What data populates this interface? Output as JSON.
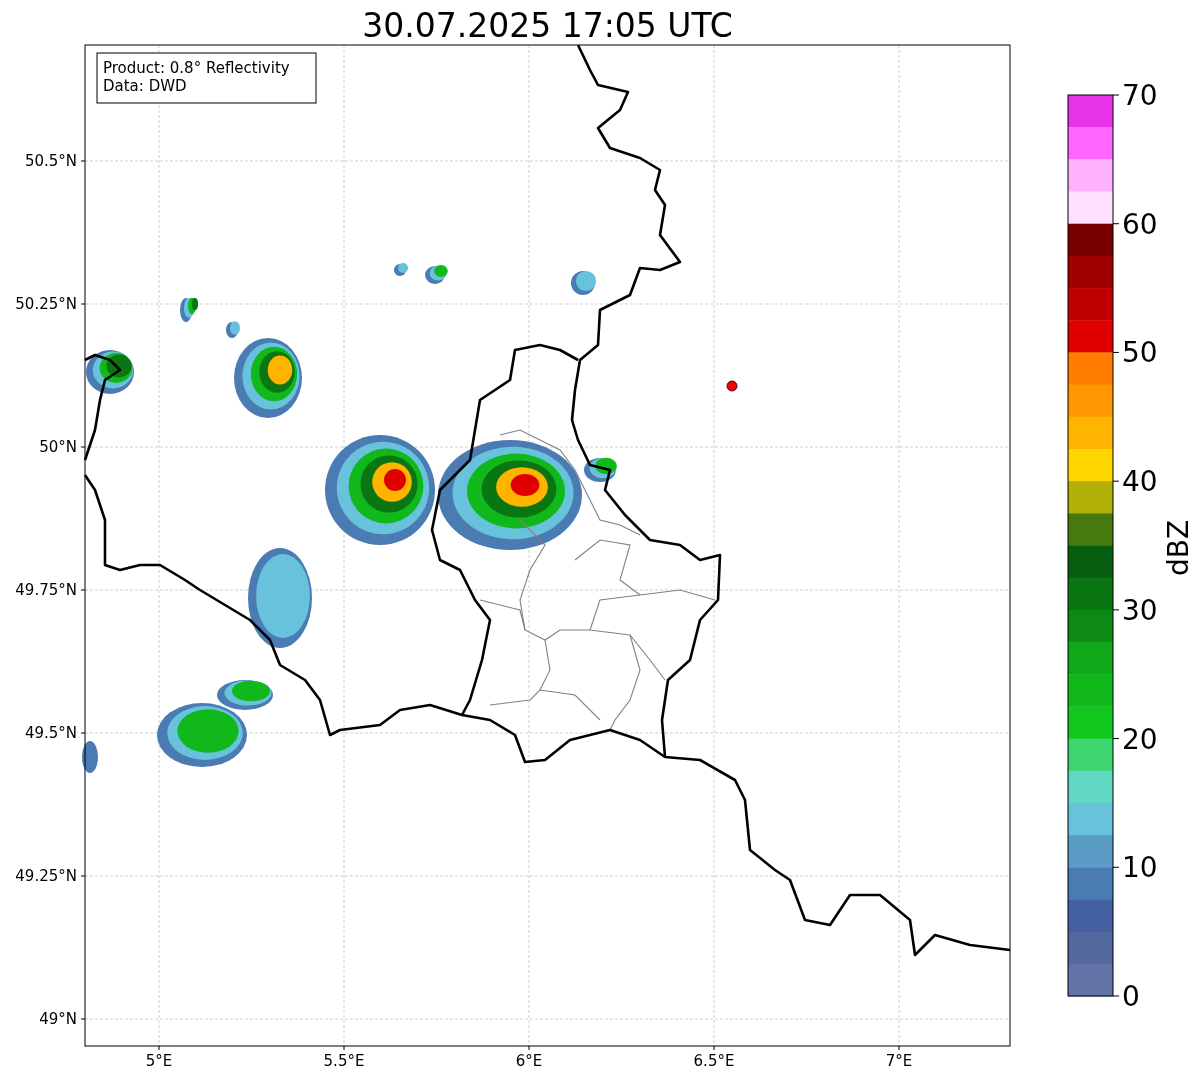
{
  "title": "30.07.2025 17:05 UTC",
  "legend": [
    "Product: 0.8° Reflectivity",
    "Data: DWD"
  ],
  "map": {
    "x_ticks": [
      "5°E",
      "5.5°E",
      "6°E",
      "6.5°E",
      "7°E"
    ],
    "y_ticks": [
      "50.5°N",
      "50.25°N",
      "50°N",
      "49.75°N",
      "49.5°N",
      "49.25°N",
      "49°N"
    ]
  },
  "colorbar": {
    "label": "dBZ",
    "ticks": [
      "70",
      "60",
      "50",
      "40",
      "30",
      "20",
      "10",
      "0"
    ],
    "bands": [
      {
        "color": "#e833e8"
      },
      {
        "color": "#ff66ff"
      },
      {
        "color": "#ffb0ff"
      },
      {
        "color": "#ffdfff"
      },
      {
        "color": "#7a0000"
      },
      {
        "color": "#a00000"
      },
      {
        "color": "#c00000"
      },
      {
        "color": "#e00000"
      },
      {
        "color": "#ff7c00"
      },
      {
        "color": "#ff9800"
      },
      {
        "color": "#ffb400"
      },
      {
        "color": "#ffd700"
      },
      {
        "color": "#b0b006"
      },
      {
        "color": "#467a0c"
      },
      {
        "color": "#085e10"
      },
      {
        "color": "#0a7612"
      },
      {
        "color": "#0c8a14"
      },
      {
        "color": "#10a818"
      },
      {
        "color": "#10b81c"
      },
      {
        "color": "#10c81c"
      },
      {
        "color": "#3dd66e"
      },
      {
        "color": "#60d8c3"
      },
      {
        "color": "#68c2dc"
      },
      {
        "color": "#5b9cc6"
      },
      {
        "color": "#4a7bb2"
      },
      {
        "color": "#4560a2"
      },
      {
        "color": "#5468a0"
      },
      {
        "color": "#6574a6"
      }
    ]
  }
}
